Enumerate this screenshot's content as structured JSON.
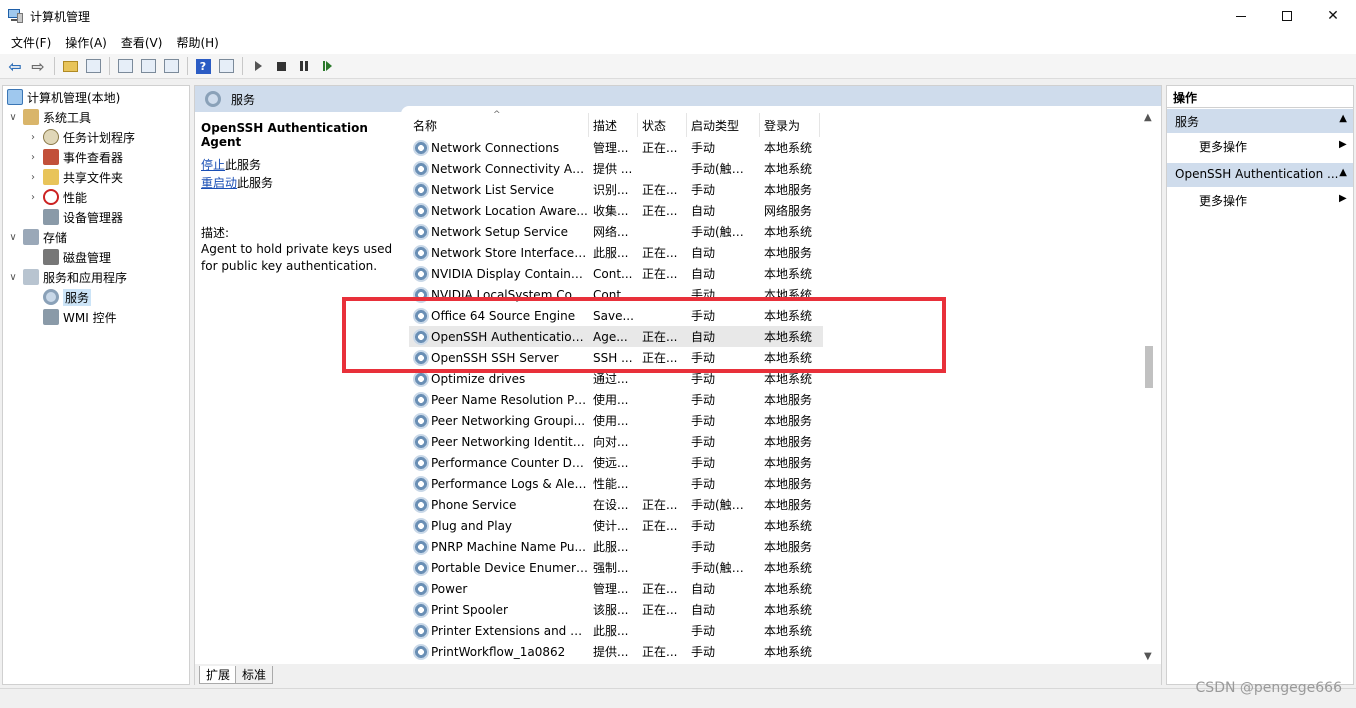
{
  "window": {
    "title": "计算机管理"
  },
  "menu": [
    "文件(F)",
    "操作(A)",
    "查看(V)",
    "帮助(H)"
  ],
  "tree": {
    "items": [
      {
        "label": "计算机管理(本地)",
        "icon": "computer-manage-icon"
      },
      {
        "label": "系统工具",
        "icon": "system-tools-icon",
        "expander": "∨"
      },
      {
        "label": "任务计划程序",
        "icon": "task-scheduler-icon",
        "expander": "›"
      },
      {
        "label": "事件查看器",
        "icon": "event-viewer-icon",
        "expander": "›"
      },
      {
        "label": "共享文件夹",
        "icon": "shared-folders-icon",
        "expander": "›"
      },
      {
        "label": "性能",
        "icon": "performance-icon",
        "expander": "›"
      },
      {
        "label": "设备管理器",
        "icon": "device-manager-icon"
      },
      {
        "label": "存储",
        "icon": "storage-icon",
        "expander": "∨"
      },
      {
        "label": "磁盘管理",
        "icon": "disk-manage-icon"
      },
      {
        "label": "服务和应用程序",
        "icon": "services-apps-icon",
        "expander": "∨"
      },
      {
        "label": "服务",
        "icon": "services-icon"
      },
      {
        "label": "WMI 控件",
        "icon": "wmi-icon"
      }
    ]
  },
  "middle": {
    "header": "服务",
    "desc": {
      "title": "OpenSSH Authentication Agent",
      "stop_link": "停止",
      "stop_suffix": "此服务",
      "restart_link": "重启动",
      "restart_suffix": "此服务",
      "desc_label": "描述:",
      "desc_line1": "Agent to hold private keys used",
      "desc_line2": "for public key authentication."
    },
    "columns": [
      "名称",
      "描述",
      "状态",
      "启动类型",
      "登录为"
    ],
    "rows": [
      {
        "name": "Network Connections",
        "desc": "管理...",
        "state": "正在...",
        "start": "手动",
        "logon": "本地系统"
      },
      {
        "name": "Network Connectivity Ass...",
        "desc": "提供 ...",
        "state": "",
        "start": "手动(触发...",
        "logon": "本地系统"
      },
      {
        "name": "Network List Service",
        "desc": "识别...",
        "state": "正在...",
        "start": "手动",
        "logon": "本地服务"
      },
      {
        "name": "Network Location Aware...",
        "desc": "收集...",
        "state": "正在...",
        "start": "自动",
        "logon": "网络服务"
      },
      {
        "name": "Network Setup Service",
        "desc": "网络...",
        "state": "",
        "start": "手动(触发...",
        "logon": "本地系统"
      },
      {
        "name": "Network Store Interface ...",
        "desc": "此服...",
        "state": "正在...",
        "start": "自动",
        "logon": "本地服务"
      },
      {
        "name": "NVIDIA Display Containe...",
        "desc": "Cont...",
        "state": "正在...",
        "start": "自动",
        "logon": "本地系统"
      },
      {
        "name": "NVIDIA LocalSystem Con...",
        "desc": "Cont...",
        "state": "",
        "start": "手动",
        "logon": "本地系统"
      },
      {
        "name": "Office 64 Source Engine",
        "desc": "Save...",
        "state": "",
        "start": "手动",
        "logon": "本地系统"
      },
      {
        "name": "OpenSSH Authentication ...",
        "desc": "Age...",
        "state": "正在...",
        "start": "自动",
        "logon": "本地系统"
      },
      {
        "name": "OpenSSH SSH Server",
        "desc": "SSH ...",
        "state": "正在...",
        "start": "手动",
        "logon": "本地系统"
      },
      {
        "name": "Optimize drives",
        "desc": "通过...",
        "state": "",
        "start": "手动",
        "logon": "本地系统"
      },
      {
        "name": "Peer Name Resolution Pr...",
        "desc": "使用...",
        "state": "",
        "start": "手动",
        "logon": "本地服务"
      },
      {
        "name": "Peer Networking Groupi...",
        "desc": "使用...",
        "state": "",
        "start": "手动",
        "logon": "本地服务"
      },
      {
        "name": "Peer Networking Identity...",
        "desc": "向对...",
        "state": "",
        "start": "手动",
        "logon": "本地服务"
      },
      {
        "name": "Performance Counter DL...",
        "desc": "使远...",
        "state": "",
        "start": "手动",
        "logon": "本地服务"
      },
      {
        "name": "Performance Logs & Aler...",
        "desc": "性能...",
        "state": "",
        "start": "手动",
        "logon": "本地服务"
      },
      {
        "name": "Phone Service",
        "desc": "在设...",
        "state": "正在...",
        "start": "手动(触发...",
        "logon": "本地服务"
      },
      {
        "name": "Plug and Play",
        "desc": "使计...",
        "state": "正在...",
        "start": "手动",
        "logon": "本地系统"
      },
      {
        "name": "PNRP Machine Name Pu...",
        "desc": "此服...",
        "state": "",
        "start": "手动",
        "logon": "本地服务"
      },
      {
        "name": "Portable Device Enumera...",
        "desc": "强制...",
        "state": "",
        "start": "手动(触发...",
        "logon": "本地系统"
      },
      {
        "name": "Power",
        "desc": "管理...",
        "state": "正在...",
        "start": "自动",
        "logon": "本地系统"
      },
      {
        "name": "Print Spooler",
        "desc": "该服...",
        "state": "正在...",
        "start": "自动",
        "logon": "本地系统"
      },
      {
        "name": "Printer Extensions and N...",
        "desc": "此服...",
        "state": "",
        "start": "手动",
        "logon": "本地系统"
      },
      {
        "name": "PrintWorkflow_1a0862",
        "desc": "提供...",
        "state": "正在...",
        "start": "手动",
        "logon": "本地系统"
      }
    ],
    "tabs": [
      "扩展",
      "标准"
    ]
  },
  "actions": {
    "title": "操作",
    "section1": "服务",
    "more1": "更多操作",
    "section2": "OpenSSH Authentication ...",
    "more2": "更多操作"
  },
  "watermark": "CSDN @pengege666",
  "colors": {
    "highlight_box": "#e8303a",
    "header_bg": "#cfdcec"
  }
}
